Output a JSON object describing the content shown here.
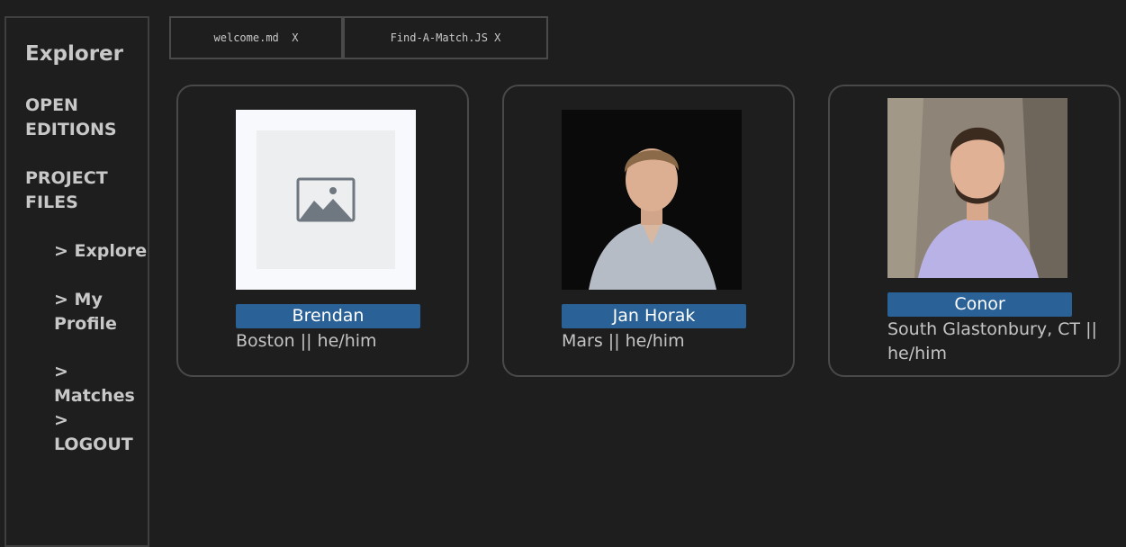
{
  "sidebar": {
    "title": "Explorer",
    "sections": [
      {
        "label": "OPEN EDITIONS"
      },
      {
        "label": "PROJECT FILES"
      }
    ],
    "items": [
      {
        "label": "> Explore"
      },
      {
        "label": "> My Profile"
      },
      {
        "label": "> Matches"
      },
      {
        "label": "> LOGOUT"
      }
    ]
  },
  "tabs": [
    {
      "label": "welcome.md  X"
    },
    {
      "label": "Find-A-Match.JS X"
    }
  ],
  "cards": [
    {
      "name": "Brendan",
      "info": "Boston || he/him",
      "photo": "image-placeholder-icon"
    },
    {
      "name": "Jan Horak",
      "info": "Mars || he/him",
      "photo": "portrait-photo"
    },
    {
      "name": "Conor",
      "info": "South Glastonbury, CT || he/him",
      "photo": "portrait-photo"
    }
  ],
  "colors": {
    "background": "#1e1e1e",
    "border": "#494949",
    "button": "#2a6196",
    "text": "#c4c4c4"
  }
}
